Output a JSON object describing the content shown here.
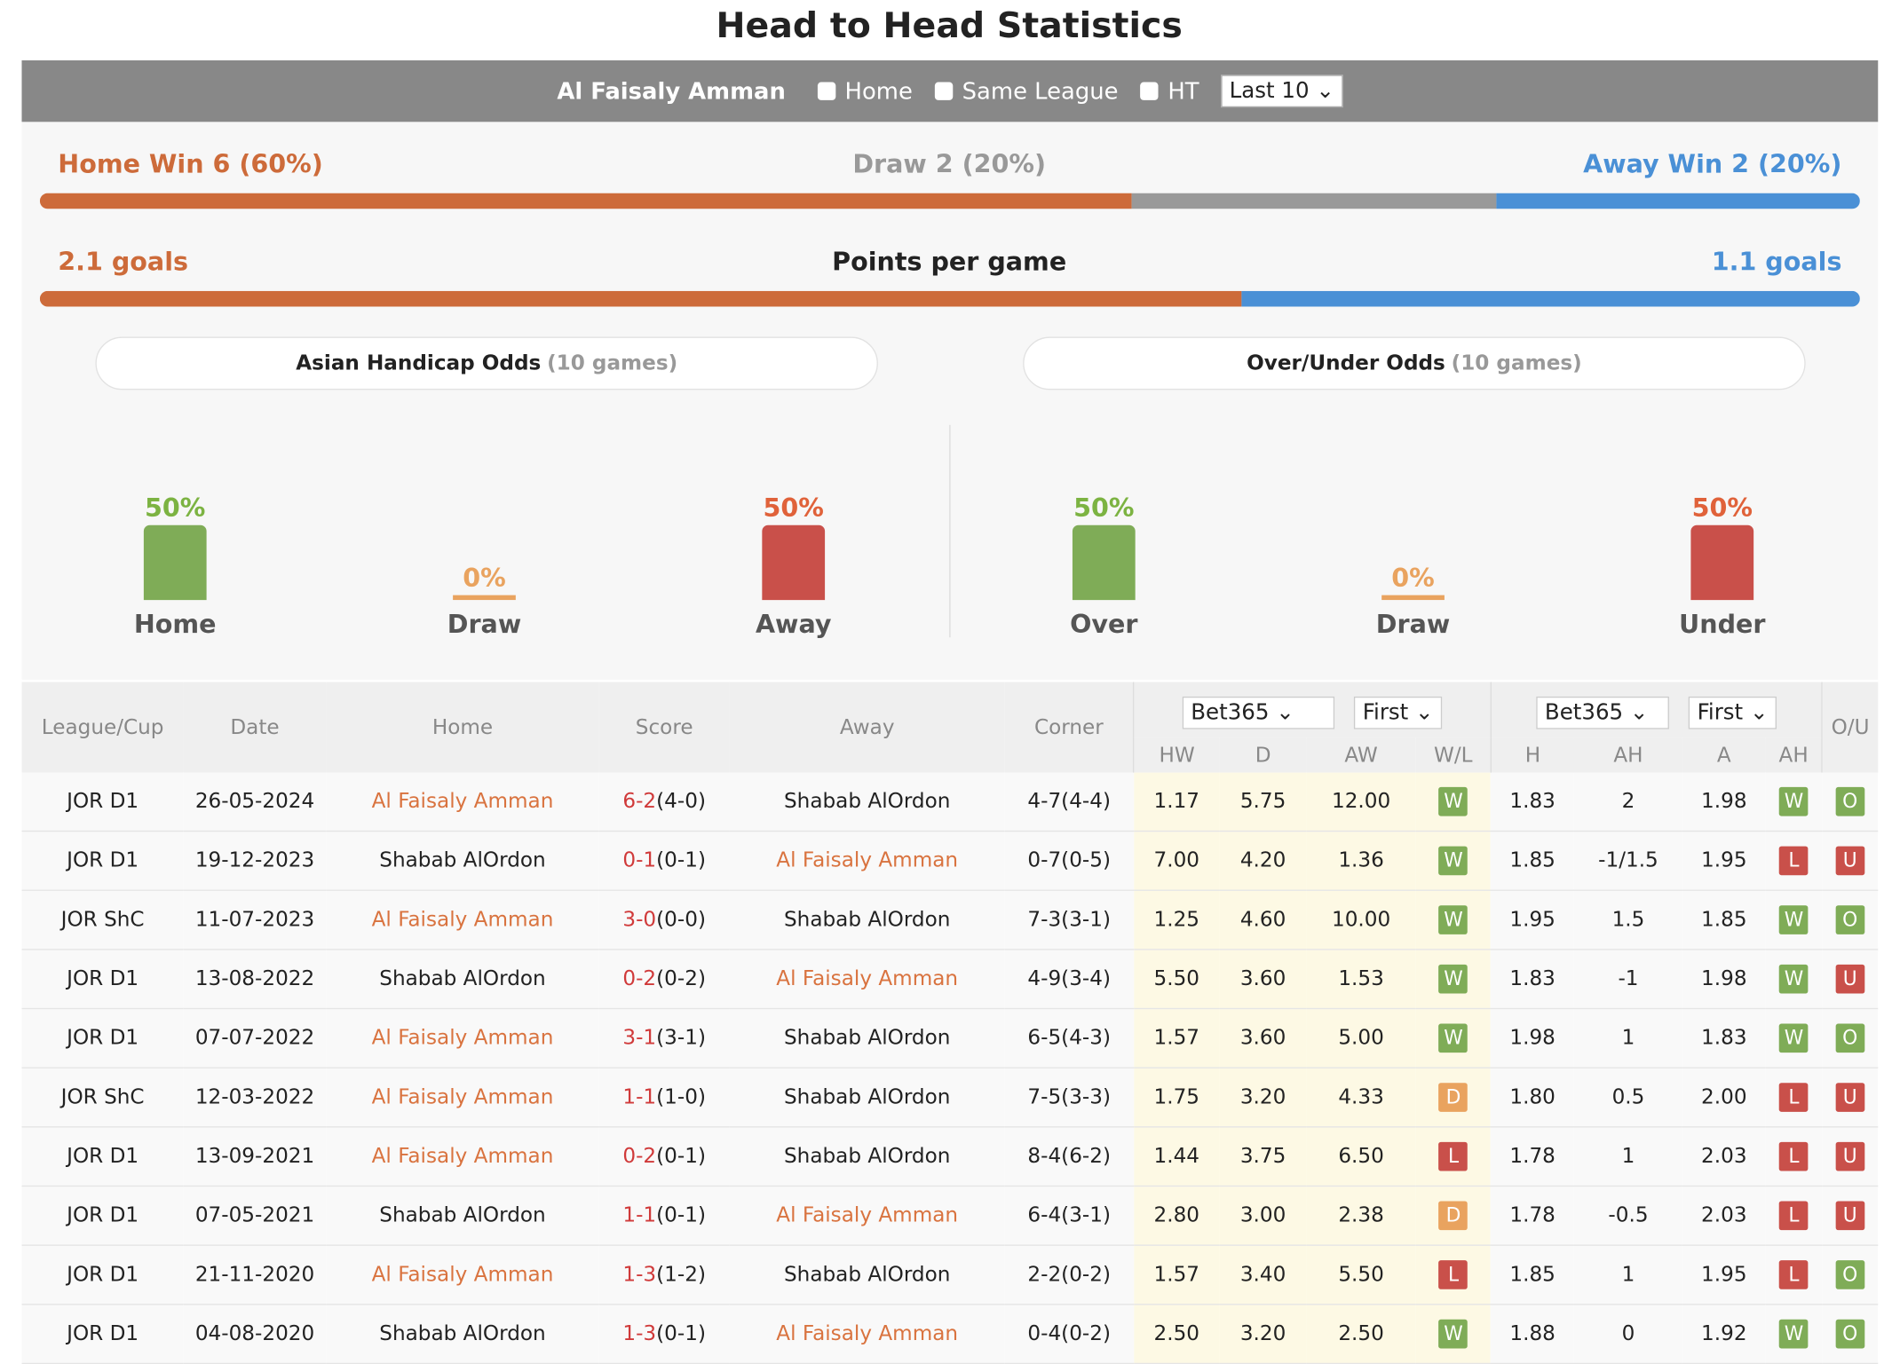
{
  "title": "Head to Head Statistics",
  "filters": {
    "team": "Al Faisaly Amman",
    "home": "Home",
    "same_league": "Same League",
    "ht": "HT",
    "last": "Last 10"
  },
  "summary": {
    "home_win": "Home Win 6 (60%)",
    "draw": "Draw 2 (20%)",
    "away_win": "Away Win 2 (20%)",
    "home_pct": 60,
    "draw_pct": 20,
    "away_pct": 20,
    "home_goals": "2.1 goals",
    "ppg": "Points per game",
    "away_goals": "1.1 goals",
    "ppg_home_share": 66
  },
  "colors": {
    "home": "#cd6b3a",
    "draw": "#999999",
    "away": "#4a90d6",
    "win": "#7fac57",
    "loss": "#c9504a",
    "d": "#e9a35f"
  },
  "ah": {
    "title": "Asian Handicap Odds",
    "games": "(10 games)",
    "items": [
      {
        "pct": "50%",
        "label": "Home",
        "value": 50
      },
      {
        "pct": "0%",
        "label": "Draw",
        "value": 0
      },
      {
        "pct": "50%",
        "label": "Away",
        "value": 50
      }
    ]
  },
  "ou": {
    "title": "Over/Under Odds",
    "games": "(10 games)",
    "items": [
      {
        "pct": "50%",
        "label": "Over",
        "value": 50
      },
      {
        "pct": "0%",
        "label": "Draw",
        "value": 0
      },
      {
        "pct": "50%",
        "label": "Under",
        "value": 50
      }
    ]
  },
  "table": {
    "headers": [
      "League/Cup",
      "Date",
      "Home",
      "Score",
      "Away",
      "Corner"
    ],
    "book1": "Bet365",
    "first1": "First",
    "book2": "Bet365",
    "first2": "First",
    "ou": "O/U",
    "sub": [
      "HW",
      "D",
      "AW",
      "W/L",
      "H",
      "AH",
      "A",
      "AH"
    ],
    "rows": [
      [
        "JOR D1",
        "26-05-2024",
        "Al Faisaly Amman",
        "6-2",
        "(4-0)",
        "Shabab AlOrdon",
        "4-7(4-4)",
        "1.17",
        "5.75",
        "12.00",
        "W",
        "1.83",
        "2",
        "1.98",
        "W",
        "O"
      ],
      [
        "JOR D1",
        "19-12-2023",
        "Shabab AlOrdon",
        "0-1",
        "(0-1)",
        "Al Faisaly Amman",
        "0-7(0-5)",
        "7.00",
        "4.20",
        "1.36",
        "W",
        "1.85",
        "-1/1.5",
        "1.95",
        "L",
        "U"
      ],
      [
        "JOR ShC",
        "11-07-2023",
        "Al Faisaly Amman",
        "3-0",
        "(0-0)",
        "Shabab AlOrdon",
        "7-3(3-1)",
        "1.25",
        "4.60",
        "10.00",
        "W",
        "1.95",
        "1.5",
        "1.85",
        "W",
        "O"
      ],
      [
        "JOR D1",
        "13-08-2022",
        "Shabab AlOrdon",
        "0-2",
        "(0-2)",
        "Al Faisaly Amman",
        "4-9(3-4)",
        "5.50",
        "3.60",
        "1.53",
        "W",
        "1.83",
        "-1",
        "1.98",
        "W",
        "U"
      ],
      [
        "JOR D1",
        "07-07-2022",
        "Al Faisaly Amman",
        "3-1",
        "(3-1)",
        "Shabab AlOrdon",
        "6-5(4-3)",
        "1.57",
        "3.60",
        "5.00",
        "W",
        "1.98",
        "1",
        "1.83",
        "W",
        "O"
      ],
      [
        "JOR ShC",
        "12-03-2022",
        "Al Faisaly Amman",
        "1-1",
        "(1-0)",
        "Shabab AlOrdon",
        "7-5(3-3)",
        "1.75",
        "3.20",
        "4.33",
        "D",
        "1.80",
        "0.5",
        "2.00",
        "L",
        "U"
      ],
      [
        "JOR D1",
        "13-09-2021",
        "Al Faisaly Amman",
        "0-2",
        "(0-1)",
        "Shabab AlOrdon",
        "8-4(6-2)",
        "1.44",
        "3.75",
        "6.50",
        "L",
        "1.78",
        "1",
        "2.03",
        "L",
        "U"
      ],
      [
        "JOR D1",
        "07-05-2021",
        "Shabab AlOrdon",
        "1-1",
        "(0-1)",
        "Al Faisaly Amman",
        "6-4(3-1)",
        "2.80",
        "3.00",
        "2.38",
        "D",
        "1.78",
        "-0.5",
        "2.03",
        "L",
        "U"
      ],
      [
        "JOR D1",
        "21-11-2020",
        "Al Faisaly Amman",
        "1-3",
        "(1-2)",
        "Shabab AlOrdon",
        "2-2(0-2)",
        "1.57",
        "3.40",
        "5.50",
        "L",
        "1.85",
        "1",
        "1.95",
        "L",
        "O"
      ],
      [
        "JOR D1",
        "04-08-2020",
        "Shabab AlOrdon",
        "1-3",
        "(0-1)",
        "Al Faisaly Amman",
        "0-4(0-2)",
        "2.50",
        "3.20",
        "2.50",
        "W",
        "1.88",
        "0",
        "1.92",
        "W",
        "O"
      ]
    ]
  }
}
